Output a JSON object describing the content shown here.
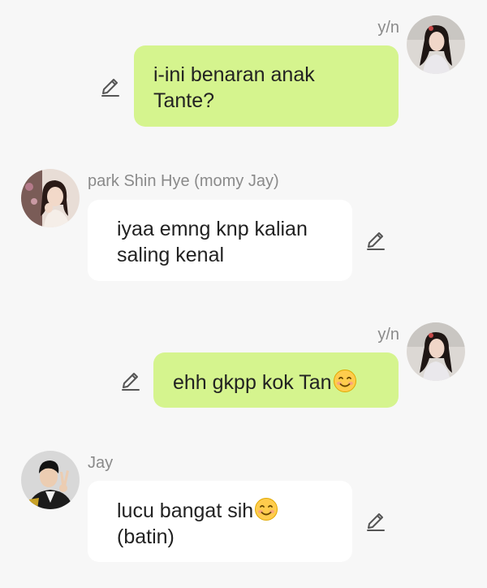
{
  "messages": [
    {
      "sender": "y/n",
      "lines": [
        "i-ini benaran anak",
        "Tante?"
      ],
      "avatar_icon": "girl-dark-hair-avatar",
      "side": "right"
    },
    {
      "sender": "park Shin Hye (momy Jay)",
      "lines": [
        "iyaa emng knp kalian",
        "saling kenal"
      ],
      "avatar_icon": "woman-avatar",
      "side": "left"
    },
    {
      "sender": "y/n",
      "lines": [
        "ehh gkpp kok Tan"
      ],
      "emoji": "smiling-face-emoji",
      "avatar_icon": "girl-dark-hair-avatar",
      "side": "right"
    },
    {
      "sender": "Jay",
      "lines": [
        "lucu bangat sih",
        "(batin)"
      ],
      "emoji": "smiling-face-emoji",
      "avatar_icon": "boy-peace-sign-avatar",
      "side": "left"
    }
  ],
  "colors": {
    "background": "#f7f7f7",
    "my_bubble": "#d5f48e",
    "their_bubble": "#ffffff",
    "name_text": "#8a8a8a",
    "message_text": "#222222",
    "edit_icon": "#555555"
  }
}
